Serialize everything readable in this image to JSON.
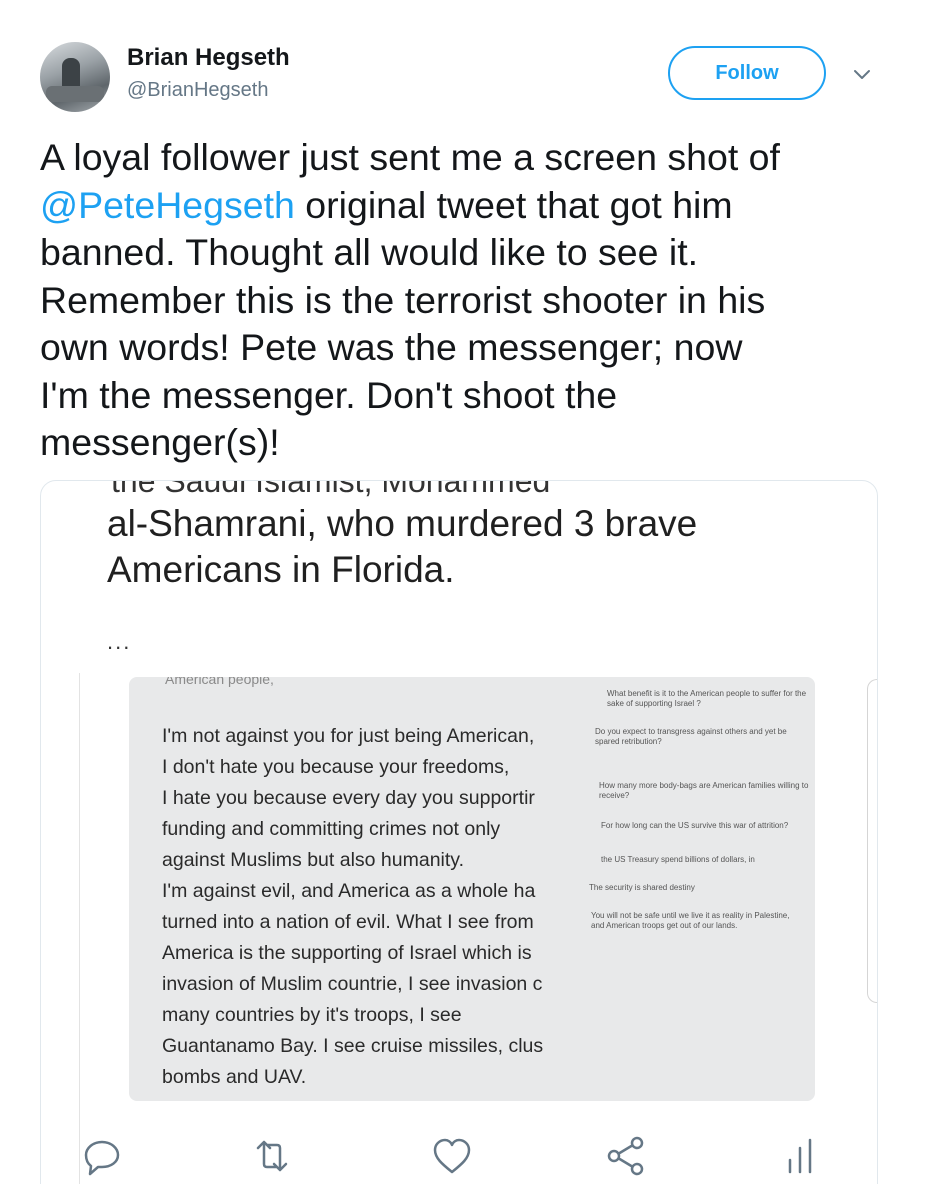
{
  "user": {
    "name": "Brian Hegseth",
    "handle": "@BrianHegseth"
  },
  "follow_label": "Follow",
  "tweet": {
    "line1": "A loyal follower just sent me a screen shot of",
    "mention": "@PeteHegseth",
    "line2_rest": " original tweet that got him",
    "line3": "banned. Thought all would like to see it.",
    "line4": "Remember this is the terrorist shooter in his",
    "line5": "own words! Pete was the messenger; now",
    "line6": "I'm the messenger. Don't shoot the",
    "line7": "messenger(s)!"
  },
  "media": {
    "cut_line": "the Saudi Islamist, Mohammed",
    "text_line1": "al-Shamrani, who murdered 3 brave",
    "text_line2": "Americans in Florida.",
    "ellipsis": "...",
    "quote_top": "American people,",
    "quote_lines": [
      "I'm not against you for just being American,",
      "I don't hate you because your freedoms,",
      "I hate you because every day you supportir",
      "funding and committing crimes not only",
      "against Muslims but also humanity.",
      "I'm against evil, and America as a whole ha",
      "turned into a nation of evil. What I see from",
      "America is the supporting of Israel which is",
      "invasion of Muslim countrie, I see invasion c",
      "many countries by it's troops, I see",
      "Guantanamo Bay. I see cruise missiles, clus",
      "bombs and UAV."
    ],
    "notes": [
      "What benefit is it to the American people to suffer for the sake of supporting Israel ?",
      "Do you expect to transgress against others and yet be spared retribution?",
      "How many more body-bags are American families willing to receive?",
      "For how long can the US survive this war of attrition?",
      "the US Treasury spend billions of dollars, in",
      "The security is shared destiny",
      "You will not be safe until we live it as reality in Palestine, and American troops get out of our lands."
    ]
  },
  "actions": {
    "reply": "reply-icon",
    "retweet": "retweet-icon",
    "like": "heart-icon",
    "share": "share-icon",
    "analytics": "analytics-icon"
  },
  "colors": {
    "accent": "#1da1f2",
    "text": "#14171a",
    "secondary": "#657786"
  }
}
